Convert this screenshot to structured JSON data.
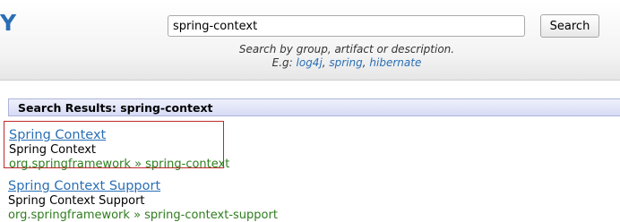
{
  "header": {
    "logo_fragment": "Y",
    "search": {
      "value": "spring-context",
      "button_label": "Search"
    },
    "hint": {
      "line1": "Search by group, artifact or description.",
      "prefix": "E.g: ",
      "examples": [
        "log4j",
        "spring",
        "hibernate"
      ],
      "separator": ", "
    }
  },
  "results": {
    "title": "Search Results: spring-context",
    "items": [
      {
        "title": "Spring Context",
        "description": "Spring Context",
        "coordinates": "org.springframework » spring-context",
        "selected": true
      },
      {
        "title": "Spring Context Support",
        "description": "Spring Context Support",
        "coordinates": "org.springframework » spring-context-support",
        "selected": false
      }
    ]
  },
  "colors": {
    "link": "#2a6fb5",
    "coordinates": "#2f7d1e",
    "selection_border": "#c0292d",
    "results_bar": "#d7dbf5"
  }
}
